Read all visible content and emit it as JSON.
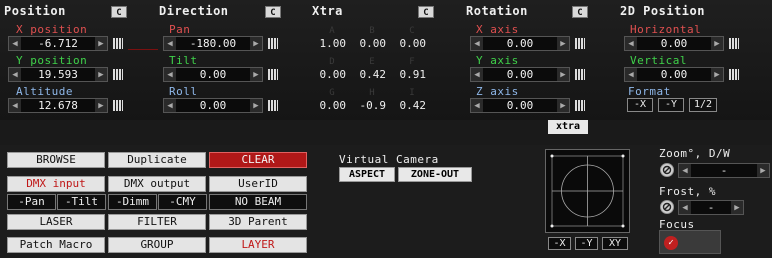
{
  "position": {
    "title": "Position",
    "c": "C",
    "x_label": "X position",
    "x_value": "-6.712",
    "y_label": "Y position",
    "y_value": "19.593",
    "alt_label": "Altitude",
    "alt_value": "12.678"
  },
  "direction": {
    "title": "Direction",
    "c": "C",
    "pan_label": "Pan",
    "pan_value": "-180.00",
    "tilt_label": "Tilt",
    "tilt_value": "0.00",
    "roll_label": "Roll",
    "roll_value": "0.00"
  },
  "xtra": {
    "title": "Xtra",
    "c": "C",
    "ghost_row1": [
      "A",
      "B",
      "C"
    ],
    "ghost_row2": [
      "D",
      "E",
      "F"
    ],
    "ghost_row3": [
      "G",
      "H",
      "I"
    ],
    "row1": [
      "1.00",
      "0.00",
      "0.00"
    ],
    "row2": [
      "0.00",
      "0.42",
      "0.91"
    ],
    "row3": [
      "0.00",
      "-0.9",
      "0.42"
    ],
    "button": "xtra"
  },
  "rotation": {
    "title": "Rotation",
    "c": "C",
    "x_label": "X axis",
    "x_value": "0.00",
    "y_label": "Y axis",
    "y_value": "0.00",
    "z_label": "Z axis",
    "z_value": "0.00"
  },
  "pos2d": {
    "title": "2D Position",
    "h_label": "Horizontal",
    "h_value": "0.00",
    "v_label": "Vertical",
    "v_value": "0.00",
    "format_label": "Format",
    "format_buttons": [
      "-X",
      "-Y",
      "1/2"
    ]
  },
  "buttons": {
    "browse": "BROWSE",
    "duplicate": "Duplicate",
    "clear": "CLEAR",
    "dmx_input": "DMX input",
    "dmx_output": "DMX output",
    "userid": "UserID",
    "pan": "-Pan",
    "tilt": "-Tilt",
    "dimm": "-Dimm",
    "cmy": "-CMY",
    "nobeam": "NO BEAM",
    "laser": "LASER",
    "filter": "FILTER",
    "parent": "3D Parent",
    "patch_macro": "Patch Macro",
    "group": "GROUP",
    "layer": "LAYER"
  },
  "virtual_camera": {
    "title": "Virtual Camera",
    "aspect": "ASPECT",
    "zone_out": "ZONE-OUT"
  },
  "canvas_buttons": [
    "-X",
    "-Y",
    "XY"
  ],
  "right_panel": {
    "zoom_label": "Zoom°, D/W",
    "zoom_value": "-",
    "frost_label": "Frost, %",
    "frost_value": "-",
    "focus_label": "Focus"
  },
  "colors": {
    "accent_red": "#b01818",
    "label_red": "#e05050",
    "label_green": "#3fd24a",
    "label_blue": "#8fb8ea"
  }
}
